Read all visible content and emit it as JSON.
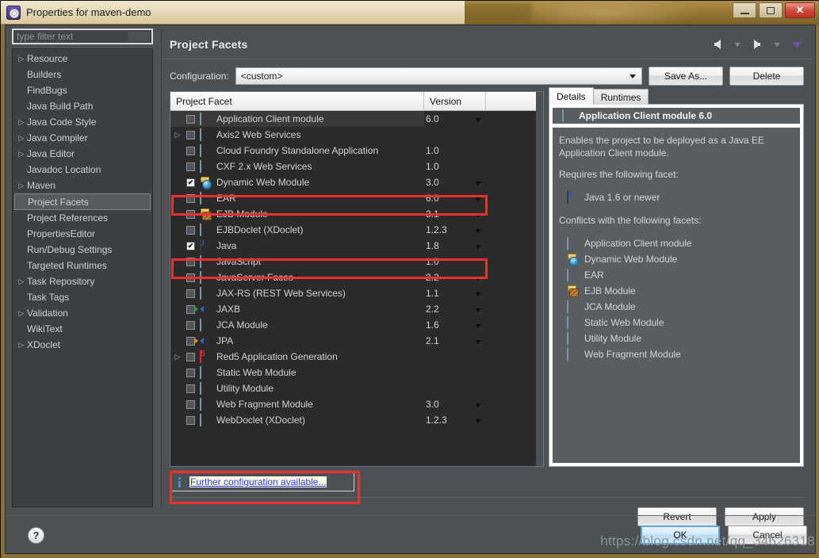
{
  "window": {
    "title": "Properties for maven-demo",
    "app_icon": "eclipse-icon",
    "controls": {
      "minimize": "minimize-icon",
      "maximize": "maximize-icon",
      "close": "✕"
    }
  },
  "sidebar": {
    "filter_placeholder": "type filter text",
    "items": [
      {
        "label": "Resource",
        "expandable": true,
        "selected": false
      },
      {
        "label": "Builders",
        "expandable": false,
        "selected": false
      },
      {
        "label": "FindBugs",
        "expandable": false,
        "selected": false
      },
      {
        "label": "Java Build Path",
        "expandable": false,
        "selected": false
      },
      {
        "label": "Java Code Style",
        "expandable": true,
        "selected": false
      },
      {
        "label": "Java Compiler",
        "expandable": true,
        "selected": false
      },
      {
        "label": "Java Editor",
        "expandable": true,
        "selected": false
      },
      {
        "label": "Javadoc Location",
        "expandable": false,
        "selected": false
      },
      {
        "label": "Maven",
        "expandable": true,
        "selected": false
      },
      {
        "label": "Project Facets",
        "expandable": false,
        "selected": true
      },
      {
        "label": "Project References",
        "expandable": false,
        "selected": false
      },
      {
        "label": "PropertiesEditor",
        "expandable": false,
        "selected": false
      },
      {
        "label": "Run/Debug Settings",
        "expandable": false,
        "selected": false
      },
      {
        "label": "Targeted Runtimes",
        "expandable": false,
        "selected": false
      },
      {
        "label": "Task Repository",
        "expandable": true,
        "selected": false
      },
      {
        "label": "Task Tags",
        "expandable": false,
        "selected": false
      },
      {
        "label": "Validation",
        "expandable": true,
        "selected": false
      },
      {
        "label": "WikiText",
        "expandable": false,
        "selected": false
      },
      {
        "label": "XDoclet",
        "expandable": true,
        "selected": false
      }
    ]
  },
  "page": {
    "title": "Project Facets",
    "nav": {
      "back": "back-arrow-icon",
      "forward": "forward-arrow-icon",
      "menu": "chevron-down-icon"
    }
  },
  "configuration": {
    "label": "Configuration:",
    "value": "<custom>",
    "save_as_label": "Save As...",
    "delete_label": "Delete"
  },
  "facet_table": {
    "columns": [
      "Project Facet",
      "Version"
    ],
    "rows": [
      {
        "name": "Application Client module",
        "version": "6.0",
        "checked": false,
        "expandable": false,
        "icon": "doc-icon",
        "dropdown": true,
        "selected": true,
        "highlighted": false
      },
      {
        "name": "Axis2 Web Services",
        "version": "",
        "checked": false,
        "expandable": true,
        "icon": "doc-icon",
        "dropdown": false,
        "selected": false,
        "highlighted": false
      },
      {
        "name": "Cloud Foundry Standalone Application",
        "version": "1.0",
        "checked": false,
        "expandable": false,
        "icon": "doc-icon",
        "dropdown": false,
        "selected": false,
        "highlighted": false
      },
      {
        "name": "CXF 2.x Web Services",
        "version": "1.0",
        "checked": false,
        "expandable": false,
        "icon": "doc-icon",
        "dropdown": false,
        "selected": false,
        "highlighted": false
      },
      {
        "name": "Dynamic Web Module",
        "version": "3.0",
        "checked": true,
        "expandable": false,
        "icon": "web-module-icon",
        "dropdown": true,
        "selected": false,
        "highlighted": true
      },
      {
        "name": "EAR",
        "version": "6.0",
        "checked": false,
        "expandable": false,
        "icon": "doc-icon",
        "dropdown": true,
        "selected": false,
        "highlighted": false
      },
      {
        "name": "EJB Module",
        "version": "3.1",
        "checked": false,
        "expandable": false,
        "icon": "ejb-icon",
        "dropdown": true,
        "selected": false,
        "highlighted": false
      },
      {
        "name": "EJBDoclet (XDoclet)",
        "version": "1.2.3",
        "checked": false,
        "expandable": false,
        "icon": "doc-icon",
        "dropdown": true,
        "selected": false,
        "highlighted": false
      },
      {
        "name": "Java",
        "version": "1.8",
        "checked": true,
        "expandable": false,
        "icon": "java-icon",
        "dropdown": true,
        "selected": false,
        "highlighted": true
      },
      {
        "name": "JavaScript",
        "version": "1.0",
        "checked": false,
        "expandable": false,
        "icon": "doc-icon",
        "dropdown": false,
        "selected": false,
        "highlighted": false
      },
      {
        "name": "JavaServer Faces",
        "version": "2.2",
        "checked": false,
        "expandable": false,
        "icon": "doc-icon",
        "dropdown": true,
        "selected": false,
        "highlighted": false
      },
      {
        "name": "JAX-RS (REST Web Services)",
        "version": "1.1",
        "checked": false,
        "expandable": false,
        "icon": "doc-icon",
        "dropdown": true,
        "selected": false,
        "highlighted": false
      },
      {
        "name": "JAXB",
        "version": "2.2",
        "checked": false,
        "expandable": false,
        "icon": "xml-icon",
        "dropdown": true,
        "selected": false,
        "highlighted": false
      },
      {
        "name": "JCA Module",
        "version": "1.6",
        "checked": false,
        "expandable": false,
        "icon": "doc-icon",
        "dropdown": true,
        "selected": false,
        "highlighted": false
      },
      {
        "name": "JPA",
        "version": "2.1",
        "checked": false,
        "expandable": false,
        "icon": "xml-orange-icon",
        "dropdown": true,
        "selected": false,
        "highlighted": false
      },
      {
        "name": "Red5 Application Generation",
        "version": "",
        "checked": false,
        "expandable": true,
        "icon": "red5-icon",
        "dropdown": false,
        "selected": false,
        "highlighted": false
      },
      {
        "name": "Static Web Module",
        "version": "",
        "checked": false,
        "expandable": false,
        "icon": "doc-icon",
        "dropdown": false,
        "selected": false,
        "highlighted": false
      },
      {
        "name": "Utility Module",
        "version": "",
        "checked": false,
        "expandable": false,
        "icon": "doc-icon",
        "dropdown": false,
        "selected": false,
        "highlighted": false
      },
      {
        "name": "Web Fragment Module",
        "version": "3.0",
        "checked": false,
        "expandable": false,
        "icon": "doc-icon",
        "dropdown": true,
        "selected": false,
        "highlighted": false
      },
      {
        "name": "WebDoclet (XDoclet)",
        "version": "1.2.3",
        "checked": false,
        "expandable": false,
        "icon": "doc-icon",
        "dropdown": true,
        "selected": false,
        "highlighted": false
      }
    ]
  },
  "details": {
    "tabs": [
      {
        "label": "Details",
        "active": true
      },
      {
        "label": "Runtimes",
        "active": false
      }
    ],
    "header": "Application Client module 6.0",
    "header_icon": "doc-icon",
    "description": "Enables the project to be deployed as a Java EE Application Client module.",
    "requires_label": "Requires the following facet:",
    "requires": [
      {
        "label": "Java 1.6 or newer",
        "icon": "java-icon"
      }
    ],
    "conflicts_label": "Conflicts with the following facets:",
    "conflicts": [
      {
        "label": "Application Client module",
        "icon": "doc-icon"
      },
      {
        "label": "Dynamic Web Module",
        "icon": "web-module-icon"
      },
      {
        "label": "EAR",
        "icon": "doc-icon"
      },
      {
        "label": "EJB Module",
        "icon": "ejb-icon"
      },
      {
        "label": "JCA Module",
        "icon": "doc-icon"
      },
      {
        "label": "Static Web Module",
        "icon": "doc-icon"
      },
      {
        "label": "Utility Module",
        "icon": "doc-icon"
      },
      {
        "label": "Web Fragment Module",
        "icon": "doc-icon"
      }
    ]
  },
  "further": {
    "icon": "info-icon",
    "link": "Further configuration available..."
  },
  "actions": {
    "revert": "Revert",
    "apply": "Apply",
    "ok": "OK",
    "cancel": "Cancel",
    "help": "?"
  },
  "watermark": "https://blog.csdn.net/qq_34626318",
  "colors": {
    "highlight_red": "#f22f2f",
    "title_gold": "#8a7138",
    "panel_bg": "#4b5154",
    "table_bg": "#2b2b2b",
    "link_blue": "#2b3df0",
    "ok_border": "#5ba7de"
  }
}
